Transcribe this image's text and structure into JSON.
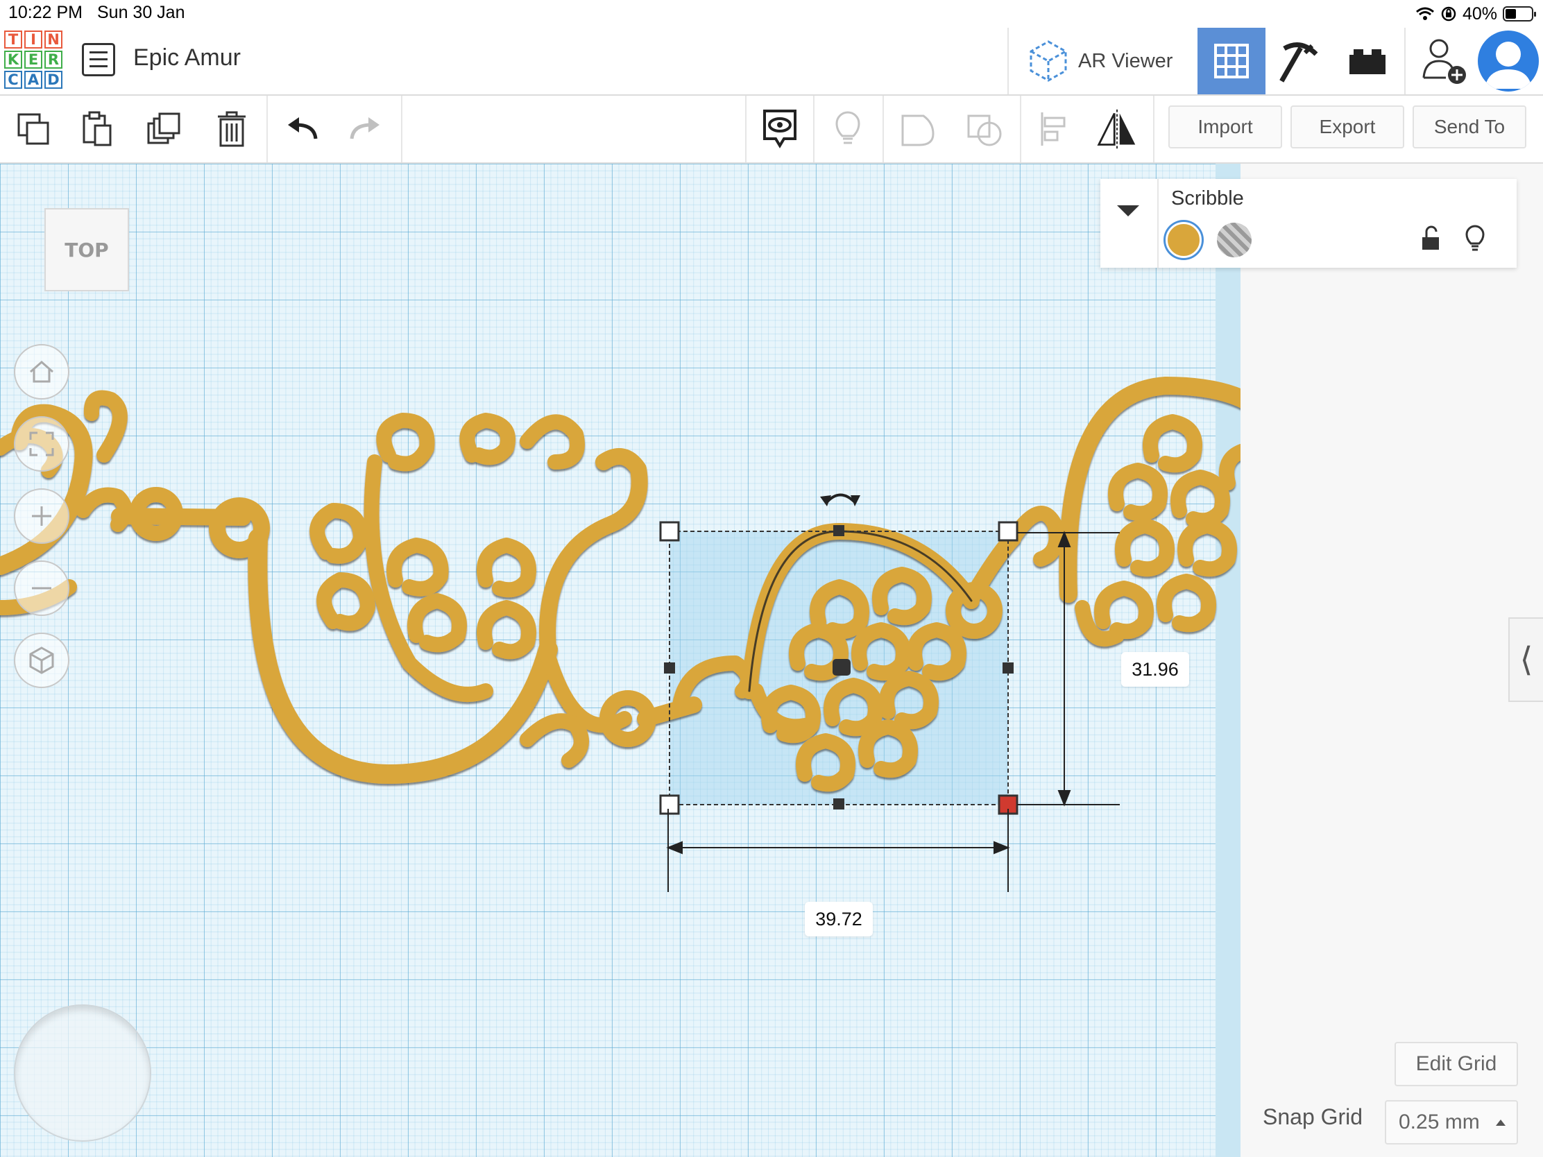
{
  "status": {
    "time": "10:22 PM",
    "date": "Sun 30 Jan",
    "battery": "40%"
  },
  "app": {
    "logo_letters": [
      "T",
      "I",
      "N",
      "K",
      "E",
      "R",
      "C",
      "A",
      "D"
    ],
    "project_name": "Epic Amur",
    "ar_viewer_label": "AR Viewer"
  },
  "toolbar": {
    "import_label": "Import",
    "export_label": "Export",
    "send_to_label": "Send To"
  },
  "viewcube": {
    "face_label": "TOP"
  },
  "inspector": {
    "title": "Scribble",
    "solid_color": "#d9a63b"
  },
  "dimensions": {
    "width": "39.72",
    "depth": "31.96"
  },
  "grid": {
    "edit_label": "Edit Grid",
    "snap_label": "Snap Grid",
    "snap_value": "0.25 mm"
  },
  "colors": {
    "shape": "#d9a63b",
    "accent": "#5b8fd6",
    "grid": "#e8f5fb"
  }
}
